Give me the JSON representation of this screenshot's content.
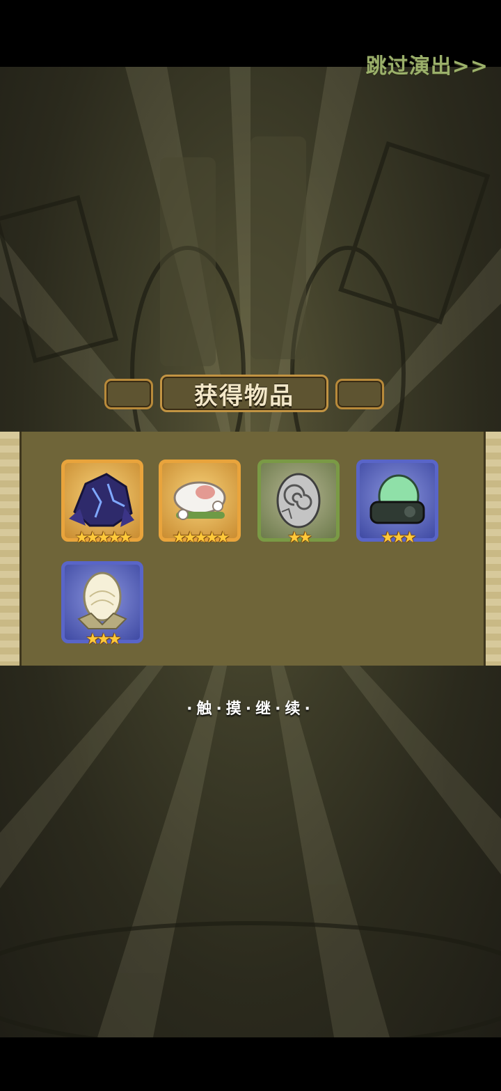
{
  "skip_label": "跳过演出>>",
  "dialog": {
    "title": "获得物品",
    "continue_hint": "·触·摸·继·续·"
  },
  "items": [
    {
      "name": "purple-crystal-egg",
      "rarity": "gold",
      "stars": "★★★★★"
    },
    {
      "name": "cloud-flower-egg",
      "rarity": "gold",
      "stars": "★★★★★"
    },
    {
      "name": "gray-spiral-egg",
      "rarity": "green",
      "stars": "★★"
    },
    {
      "name": "green-slime-egg",
      "rarity": "blue",
      "stars": "★★★"
    },
    {
      "name": "white-lotus-egg",
      "rarity": "blue",
      "stars": "★★★"
    }
  ],
  "colors": {
    "gold_frame": "#e9a43c",
    "green_frame": "#7a9a45",
    "blue_frame": "#5965c8",
    "star": "#ffc93a"
  }
}
